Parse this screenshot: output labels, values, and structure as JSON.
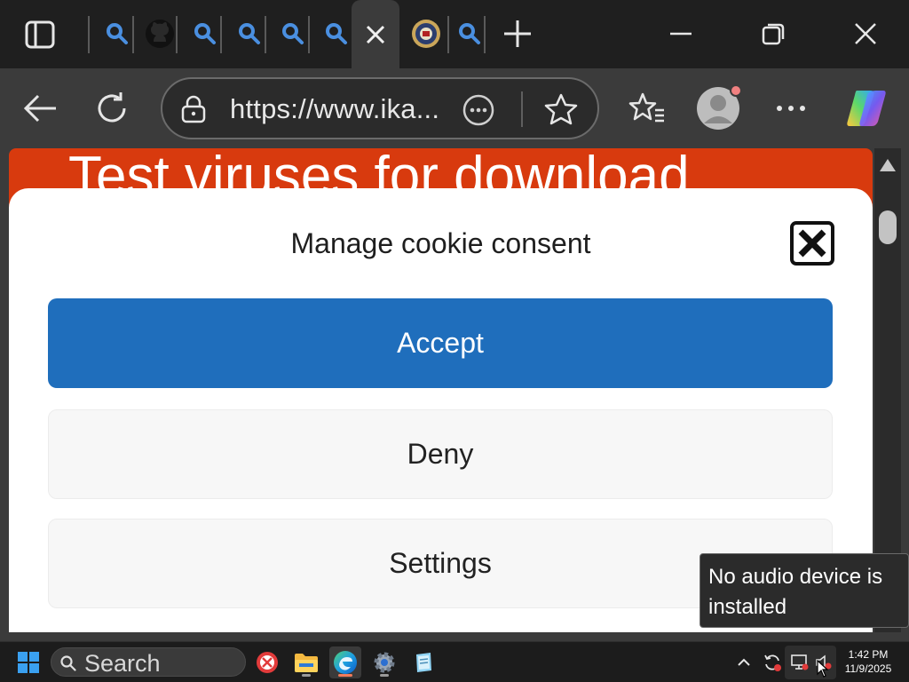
{
  "browser": {
    "tabs": [
      {
        "icon": "search-icon"
      },
      {
        "icon": "github-icon"
      },
      {
        "icon": "search-icon"
      },
      {
        "icon": "search-icon"
      },
      {
        "icon": "search-icon"
      },
      {
        "icon": "search-icon"
      },
      {
        "icon": "close-icon",
        "active": true
      },
      {
        "icon": "seal-favicon"
      },
      {
        "icon": "search-icon"
      }
    ],
    "new_tab_icon": "plus-icon",
    "url": "https://www.ika...",
    "colors": {
      "accent": "#1f6ebc",
      "header": "#d83a0e",
      "tab_search": "#4a8fe0"
    }
  },
  "page": {
    "header_title": "Test viruses for download"
  },
  "cookie_modal": {
    "title": "Manage cookie consent",
    "accept_label": "Accept",
    "deny_label": "Deny",
    "settings_label": "Settings"
  },
  "tooltip": {
    "line1": "No audio device is",
    "line2": "installed"
  },
  "taskbar": {
    "search_label": "Search",
    "time": "1:42 PM",
    "date": "11/9/2025"
  }
}
